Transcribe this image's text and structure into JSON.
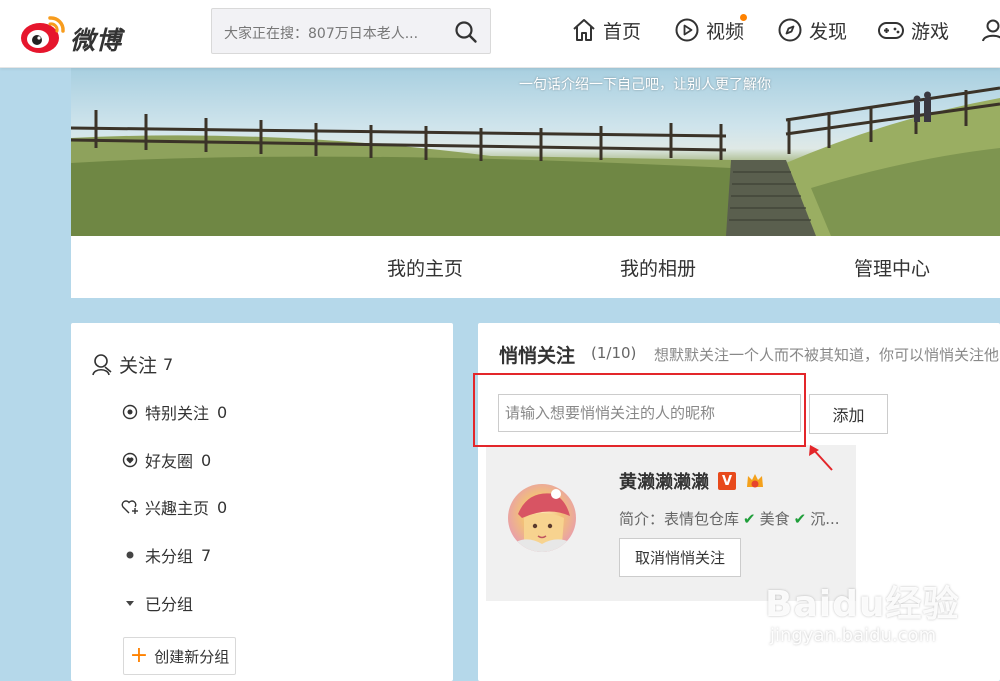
{
  "topbar": {
    "brand": "微博",
    "search": {
      "text": "大家正在搜：807万日本老人..."
    },
    "nav": [
      {
        "label": "首页",
        "icon": "home-icon"
      },
      {
        "label": "视频",
        "icon": "video-icon",
        "has_dot": true
      },
      {
        "label": "发现",
        "icon": "compass-icon"
      },
      {
        "label": "游戏",
        "icon": "gamepad-icon"
      }
    ]
  },
  "cover": {
    "tagline": "一句话介绍一下自己吧，让别人更了解你"
  },
  "profile_tabs": [
    "我的主页",
    "我的相册",
    "管理中心"
  ],
  "left_panel": {
    "header": {
      "label": "关注",
      "count": "7"
    },
    "items": [
      {
        "label": "特别关注",
        "count": "0",
        "icon": "eye-icon"
      },
      {
        "label": "好友圈",
        "count": "0",
        "icon": "heart-circle-icon"
      },
      {
        "label": "兴趣主页",
        "count": "0",
        "icon": "heart-plus-icon"
      },
      {
        "label": "未分组",
        "count": "7",
        "icon": "dot-icon"
      },
      {
        "label": "已分组",
        "count": "",
        "icon": "triangle-down-icon"
      }
    ],
    "create_group_label": "创建新分组"
  },
  "right_panel": {
    "title": "悄悄关注",
    "counter": "(1/10)",
    "description": "想默默关注一个人而不被其知道，你可以悄悄关注他",
    "input_placeholder": "请输入想要悄悄关注的人的昵称",
    "add_label": "添加",
    "user": {
      "name": "黄濑濑濑濑",
      "verified_badge": "V",
      "bio_prefix": "简介：表情包仓库",
      "bio_part2": "美食",
      "bio_part3": "沉...",
      "unfollow_label": "取消悄悄关注"
    }
  },
  "watermark": {
    "main": "Baidu经验",
    "sub": "jingyan.baidu.com"
  },
  "colors": {
    "background": "#b5d8ea",
    "accent_orange": "#ff8200",
    "highlight_red": "#e3262a",
    "check_green": "#1f9e3a"
  }
}
